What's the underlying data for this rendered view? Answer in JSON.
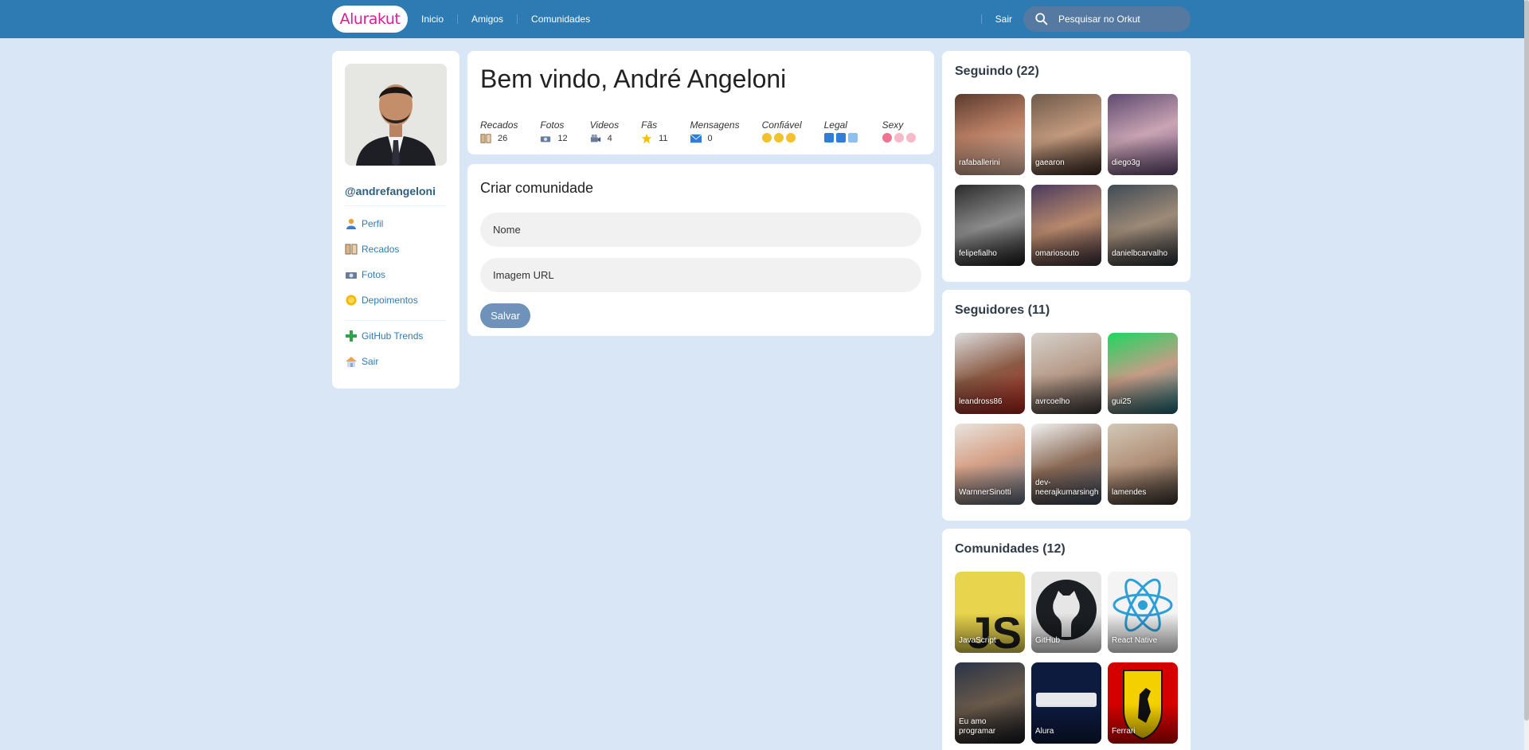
{
  "topbar": {
    "logo": "Alurakut",
    "nav": [
      "Inicio",
      "Amigos",
      "Comunidades"
    ],
    "logout": "Sair",
    "search_placeholder": "Pesquisar no Orkut"
  },
  "sidebar": {
    "username": "@andrefangeloni",
    "menu": [
      {
        "label": "Perfil",
        "icon": "user-icon"
      },
      {
        "label": "Recados",
        "icon": "book-icon"
      },
      {
        "label": "Fotos",
        "icon": "camera-icon"
      },
      {
        "label": "Depoimentos",
        "icon": "sun-icon"
      }
    ],
    "menu2": [
      {
        "label": "GitHub Trends",
        "icon": "plus-icon"
      },
      {
        "label": "Sair",
        "icon": "home-icon"
      }
    ]
  },
  "welcome": {
    "title": "Bem vindo, André Angeloni",
    "stats": [
      {
        "label": "Recados",
        "value": "26",
        "icon": "book-icon"
      },
      {
        "label": "Fotos",
        "value": "12",
        "icon": "camera-icon"
      },
      {
        "label": "Videos",
        "value": "4",
        "icon": "video-camera-icon"
      },
      {
        "label": "Fãs",
        "value": "11",
        "icon": "star-icon"
      },
      {
        "label": "Mensagens",
        "value": "0",
        "icon": "envelope-icon"
      },
      {
        "label": "Confiável",
        "value": "",
        "icon": "smiley-icon"
      },
      {
        "label": "Legal",
        "value": "",
        "icon": "cube-icon"
      },
      {
        "label": "Sexy",
        "value": "",
        "icon": "heart-icon"
      }
    ]
  },
  "create": {
    "title": "Criar comunidade",
    "name_placeholder": "Nome",
    "image_placeholder": "Imagem URL",
    "save_label": "Salvar"
  },
  "following": {
    "title": "Seguindo (22)",
    "items": [
      "rafaballerini",
      "gaearon",
      "diego3g",
      "felipefialho",
      "omariosouto",
      "danielbcarvalho"
    ]
  },
  "followers": {
    "title": "Seguidores (11)",
    "items": [
      "leandross86",
      "avrcoelho",
      "gui25",
      "WarnnerSinotti",
      "dev-neerajkumarsingh",
      "lamendes"
    ]
  },
  "communities": {
    "title": "Comunidades (12)",
    "items": [
      "JavaScript",
      "GitHub",
      "React Native",
      "Eu amo programar",
      "Alura",
      "Ferrari"
    ]
  },
  "colors": {
    "topbar": "#2E7BB4",
    "background": "#D9E6F6",
    "logo_text": "#D81D99",
    "link": "#2E7BB4",
    "button": "#6F92BB"
  }
}
